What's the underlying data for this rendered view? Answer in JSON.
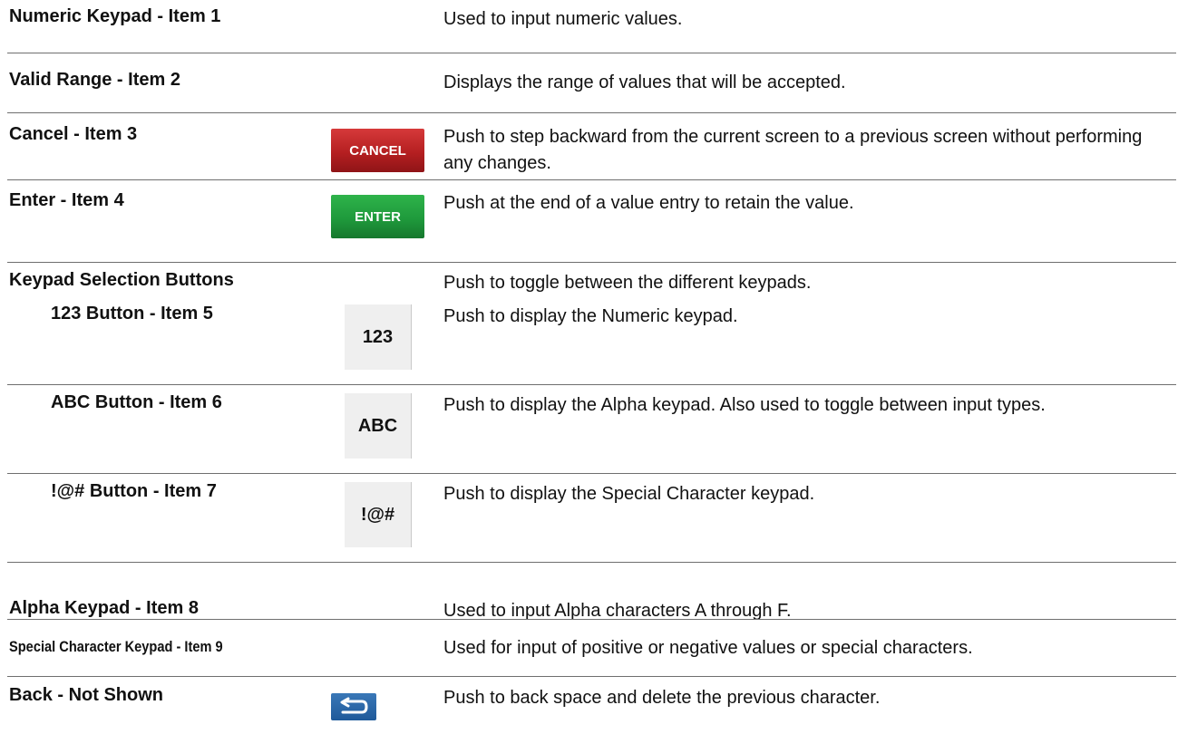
{
  "rows": [
    {
      "term": "Numeric Keypad - Item 1",
      "desc": "Used to input numeric values."
    },
    {
      "term": "Valid Range - Item 2",
      "desc": "Displays the range of values that will be accepted."
    },
    {
      "term": "Cancel - Item 3",
      "desc": "Push to step backward from the current screen to a previous screen without performing any changes.",
      "button_label": "CANCEL"
    },
    {
      "term": "Enter - Item 4",
      "desc": "Push at the end of a value entry to retain the value.",
      "button_label": "ENTER"
    },
    {
      "term": "Keypad Selection Buttons",
      "desc": "Push to toggle between the different keypads."
    },
    {
      "term": "123 Button - Item 5",
      "desc": "Push to display the Numeric keypad.",
      "button_label": "123"
    },
    {
      "term": "ABC Button - Item 6",
      "desc": "Push to display the Alpha keypad. Also used to toggle between input types.",
      "button_label": "ABC"
    },
    {
      "term": "!@# Button - Item 7",
      "desc": "Push to display the Special Character keypad.",
      "button_label": "!@#"
    },
    {
      "term": "Alpha Keypad - Item 8",
      "desc": "Used to input Alpha characters A through F."
    },
    {
      "term": "Special Character Keypad - Item 9",
      "desc": "Used for input of positive or negative values or special characters."
    },
    {
      "term": "Back - Not Shown",
      "desc": "Push to back space and delete the previous character.",
      "button_icon": "back-arrow-icon"
    }
  ],
  "colors": {
    "cancel_red": "#b51f21",
    "enter_green": "#1f9a3c",
    "key_gray": "#efefef",
    "back_blue": "#1f5a9a",
    "separator": "#6f6f6f"
  }
}
